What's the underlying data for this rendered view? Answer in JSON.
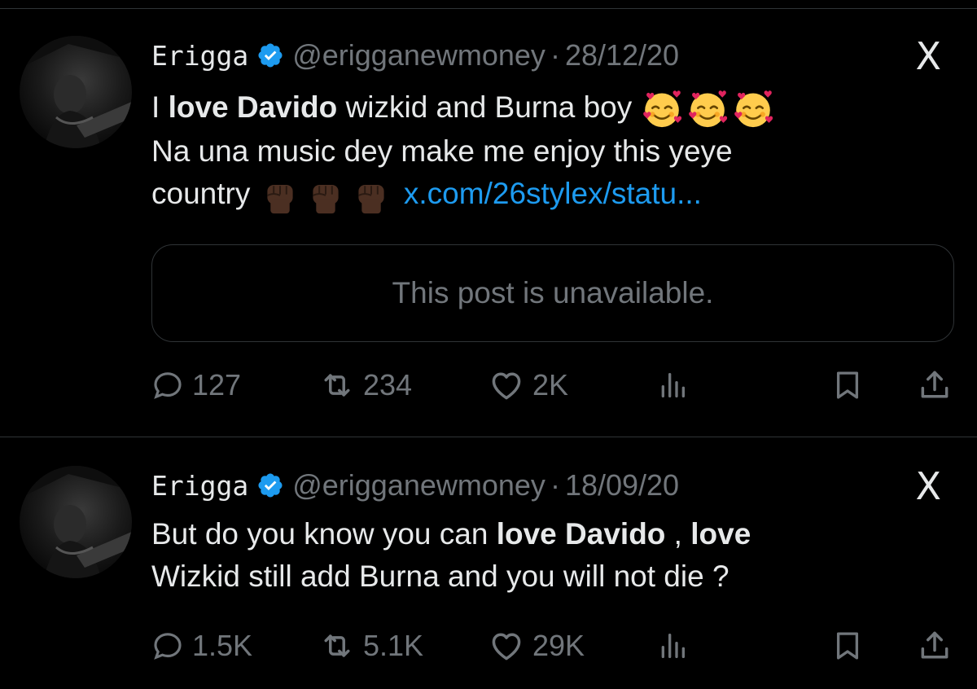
{
  "tweets": [
    {
      "name": "Erigga",
      "handle": "@erigganewmoney",
      "separator": "·",
      "date": "28/12/20",
      "x_label": "X",
      "text": {
        "line1_a": "I ",
        "line1_bold": "love Davido",
        "line1_b": " wizkid and Burna boy",
        "line2": "Na una music dey make me enjoy this yeye",
        "line3": "country",
        "link": "x.com/26stylex/statu..."
      },
      "emojis_line1": [
        "smiling-face-with-hearts",
        "smiling-face-with-hearts",
        "smiling-face-with-hearts"
      ],
      "emojis_line3": [
        "raised-fist-dark",
        "raised-fist-dark",
        "raised-fist-dark"
      ],
      "quote": "This post is unavailable.",
      "stats": {
        "replies": "127",
        "reposts": "234",
        "likes": "2K"
      }
    },
    {
      "name": "Erigga",
      "handle": "@erigganewmoney",
      "separator": "·",
      "date": "18/09/20",
      "x_label": "X",
      "text": {
        "line1_a": "But do you know you can ",
        "line1_bold": "love Davido",
        "line1_b": " , ",
        "line1_bold2": "love",
        "line2": "Wizkid still add Burna and you will not die ?"
      },
      "stats": {
        "replies": "1.5K",
        "reposts": "5.1K",
        "likes": "29K"
      }
    }
  ],
  "icons": {
    "reply": "reply-icon",
    "repost": "repost-icon",
    "like": "heart-icon",
    "views": "views-icon",
    "bookmark": "bookmark-icon",
    "share": "share-icon",
    "verified": "verified-badge-icon"
  },
  "colors": {
    "background": "#000000",
    "text": "#e7e9ea",
    "muted": "#71767b",
    "link": "#1d9bf0",
    "verified": "#1d9bf0",
    "border": "#2f3336"
  }
}
